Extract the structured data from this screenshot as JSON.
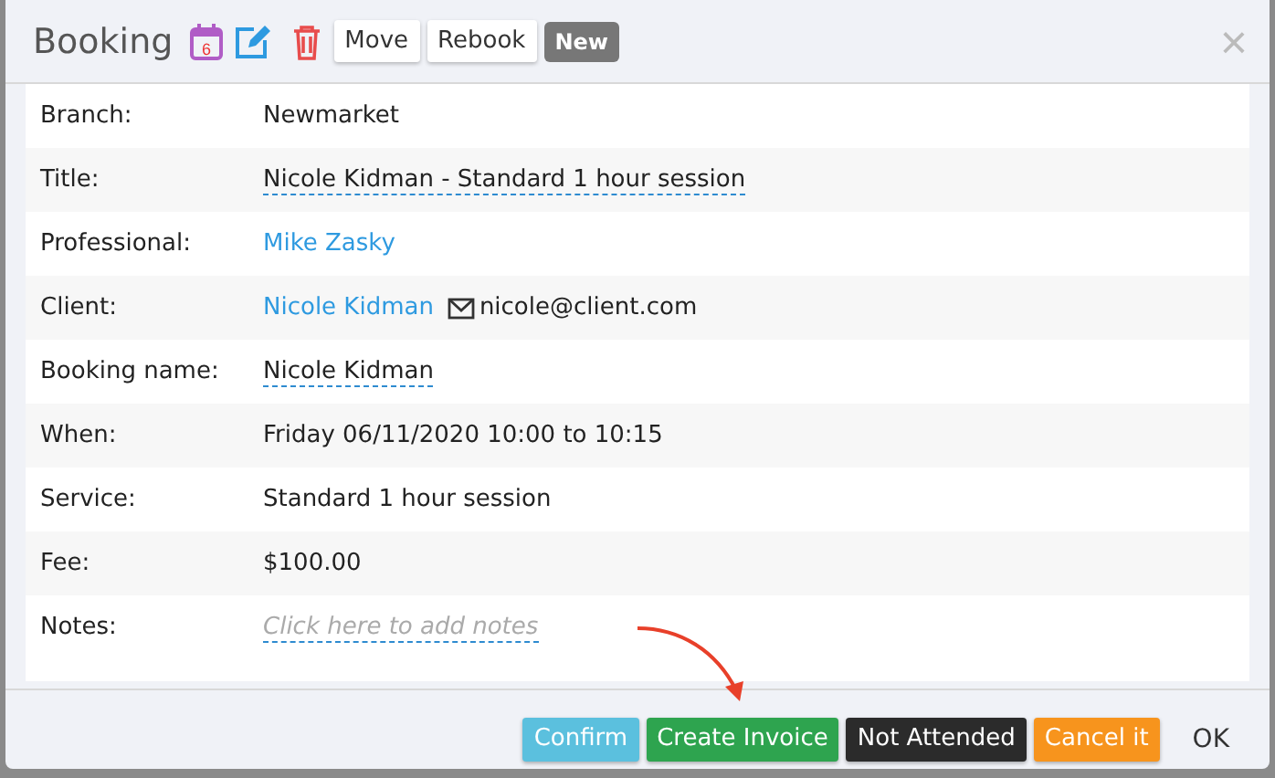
{
  "dialog": {
    "title": "Booking",
    "calendar_day": "6",
    "header_buttons": [
      {
        "label": "Move",
        "kind": "plain"
      },
      {
        "label": "Rebook",
        "kind": "plain"
      },
      {
        "label": "New",
        "kind": "status"
      }
    ],
    "close": "×"
  },
  "fields": [
    {
      "label": "Branch:",
      "value": "Newmarket",
      "kind": "text"
    },
    {
      "label": "Title:",
      "value": "Nicole Kidman - Standard 1 hour session",
      "kind": "editable"
    },
    {
      "label": "Professional:",
      "value": "Mike Zasky",
      "kind": "link"
    },
    {
      "label": "Client:",
      "value": "Nicole Kidman",
      "email": "nicole@client.com",
      "kind": "link"
    },
    {
      "label": "Booking name:",
      "value": "Nicole Kidman",
      "kind": "editable"
    },
    {
      "label": "When:",
      "value": "Friday 06/11/2020 10:00 to 10:15",
      "kind": "text"
    },
    {
      "label": "Service:",
      "value": "Standard 1 hour session",
      "kind": "text"
    },
    {
      "label": "Fee:",
      "value": "$100.00",
      "kind": "text"
    },
    {
      "label": "Notes:",
      "placeholder": "Click here to add notes",
      "kind": "placeholder"
    }
  ],
  "footer_buttons": [
    {
      "label": "Confirm",
      "color": "#5bc0de"
    },
    {
      "label": "Create Invoice",
      "color": "#2ea44f"
    },
    {
      "label": "Not Attended",
      "color": "#2b2b2b"
    },
    {
      "label": "Cancel it",
      "color": "#f7941d"
    },
    {
      "label": "OK",
      "color": "#f0f2f7"
    }
  ]
}
